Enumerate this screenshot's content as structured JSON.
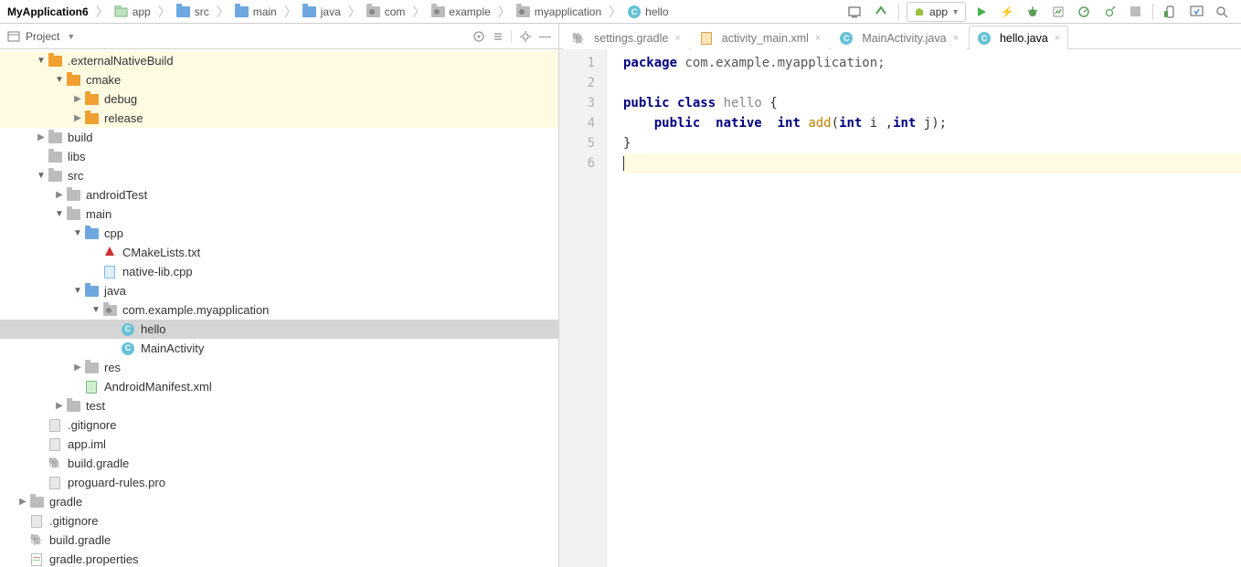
{
  "breadcrumb": [
    {
      "label": "MyApplication6",
      "icon": "",
      "bold": true
    },
    {
      "label": "app",
      "icon": "module"
    },
    {
      "label": "src",
      "icon": "folder-b"
    },
    {
      "label": "main",
      "icon": "folder-b"
    },
    {
      "label": "java",
      "icon": "folder-b"
    },
    {
      "label": "com",
      "icon": "folder-pkg"
    },
    {
      "label": "example",
      "icon": "folder-pkg"
    },
    {
      "label": "myapplication",
      "icon": "folder-pkg"
    },
    {
      "label": "hello",
      "icon": "class"
    }
  ],
  "run_config": {
    "label": "app"
  },
  "project_panel": {
    "title": "Project"
  },
  "tree": [
    {
      "indent": 1,
      "arrow": "exp",
      "icon": "folder-y",
      "label": ".externalNativeBuild",
      "hl": true
    },
    {
      "indent": 2,
      "arrow": "exp",
      "icon": "folder-y",
      "label": "cmake",
      "hl": true
    },
    {
      "indent": 3,
      "arrow": "col",
      "icon": "folder-y",
      "label": "debug",
      "hl": true
    },
    {
      "indent": 3,
      "arrow": "col",
      "icon": "folder-y",
      "label": "release",
      "hl": true
    },
    {
      "indent": 1,
      "arrow": "col",
      "icon": "folder-g",
      "label": "build"
    },
    {
      "indent": 1,
      "arrow": "",
      "icon": "folder-g",
      "label": "libs"
    },
    {
      "indent": 1,
      "arrow": "exp",
      "icon": "folder-g",
      "label": "src"
    },
    {
      "indent": 2,
      "arrow": "col",
      "icon": "folder-g",
      "label": "androidTest"
    },
    {
      "indent": 2,
      "arrow": "exp",
      "icon": "folder-g",
      "label": "main"
    },
    {
      "indent": 3,
      "arrow": "exp",
      "icon": "folder-b",
      "label": "cpp"
    },
    {
      "indent": 4,
      "arrow": "",
      "icon": "cmake",
      "label": "CMakeLists.txt"
    },
    {
      "indent": 4,
      "arrow": "",
      "icon": "cpp",
      "label": "native-lib.cpp"
    },
    {
      "indent": 3,
      "arrow": "exp",
      "icon": "folder-b",
      "label": "java"
    },
    {
      "indent": 4,
      "arrow": "exp",
      "icon": "folder-pkg",
      "label": "com.example.myapplication"
    },
    {
      "indent": 5,
      "arrow": "",
      "icon": "class",
      "label": "hello",
      "sel": true
    },
    {
      "indent": 5,
      "arrow": "",
      "icon": "class",
      "label": "MainActivity"
    },
    {
      "indent": 3,
      "arrow": "col",
      "icon": "folder-g",
      "label": "res"
    },
    {
      "indent": 3,
      "arrow": "",
      "icon": "mf",
      "label": "AndroidManifest.xml"
    },
    {
      "indent": 2,
      "arrow": "col",
      "icon": "folder-g",
      "label": "test"
    },
    {
      "indent": 1,
      "arrow": "",
      "icon": "file",
      "label": ".gitignore"
    },
    {
      "indent": 1,
      "arrow": "",
      "icon": "file",
      "label": "app.iml"
    },
    {
      "indent": 1,
      "arrow": "",
      "icon": "gradle",
      "label": "build.gradle"
    },
    {
      "indent": 1,
      "arrow": "",
      "icon": "file",
      "label": "proguard-rules.pro"
    },
    {
      "indent": 0,
      "arrow": "col",
      "icon": "folder-g",
      "label": "gradle"
    },
    {
      "indent": 0,
      "arrow": "",
      "icon": "file",
      "label": ".gitignore"
    },
    {
      "indent": 0,
      "arrow": "",
      "icon": "gradle",
      "label": "build.gradle"
    },
    {
      "indent": 0,
      "arrow": "",
      "icon": "prop",
      "label": "gradle.properties"
    }
  ],
  "tabs": [
    {
      "icon": "gradle",
      "label": "settings.gradle",
      "active": false
    },
    {
      "icon": "xml",
      "label": "activity_main.xml",
      "active": false
    },
    {
      "icon": "class",
      "label": "MainActivity.java",
      "active": false
    },
    {
      "icon": "class",
      "label": "hello.java",
      "active": true
    }
  ],
  "gutter": [
    "1",
    "2",
    "3",
    "4",
    "5",
    "6"
  ],
  "code": {
    "l1": {
      "kw1": "package",
      "rest": " com.example.myapplication;"
    },
    "l3": {
      "kw1": "public",
      "kw2": "class",
      "cls": " hello ",
      "brace": "{"
    },
    "l4": {
      "pad": "    ",
      "kw1": "public",
      "sp1": "  ",
      "kw2": "native",
      "sp2": "  ",
      "kw3": "int",
      "sp3": " ",
      "m": "add",
      "args1": "(",
      "kw4": "int",
      "args2": " i ,",
      "kw5": "int",
      "args3": " j);"
    },
    "l5": "}"
  }
}
